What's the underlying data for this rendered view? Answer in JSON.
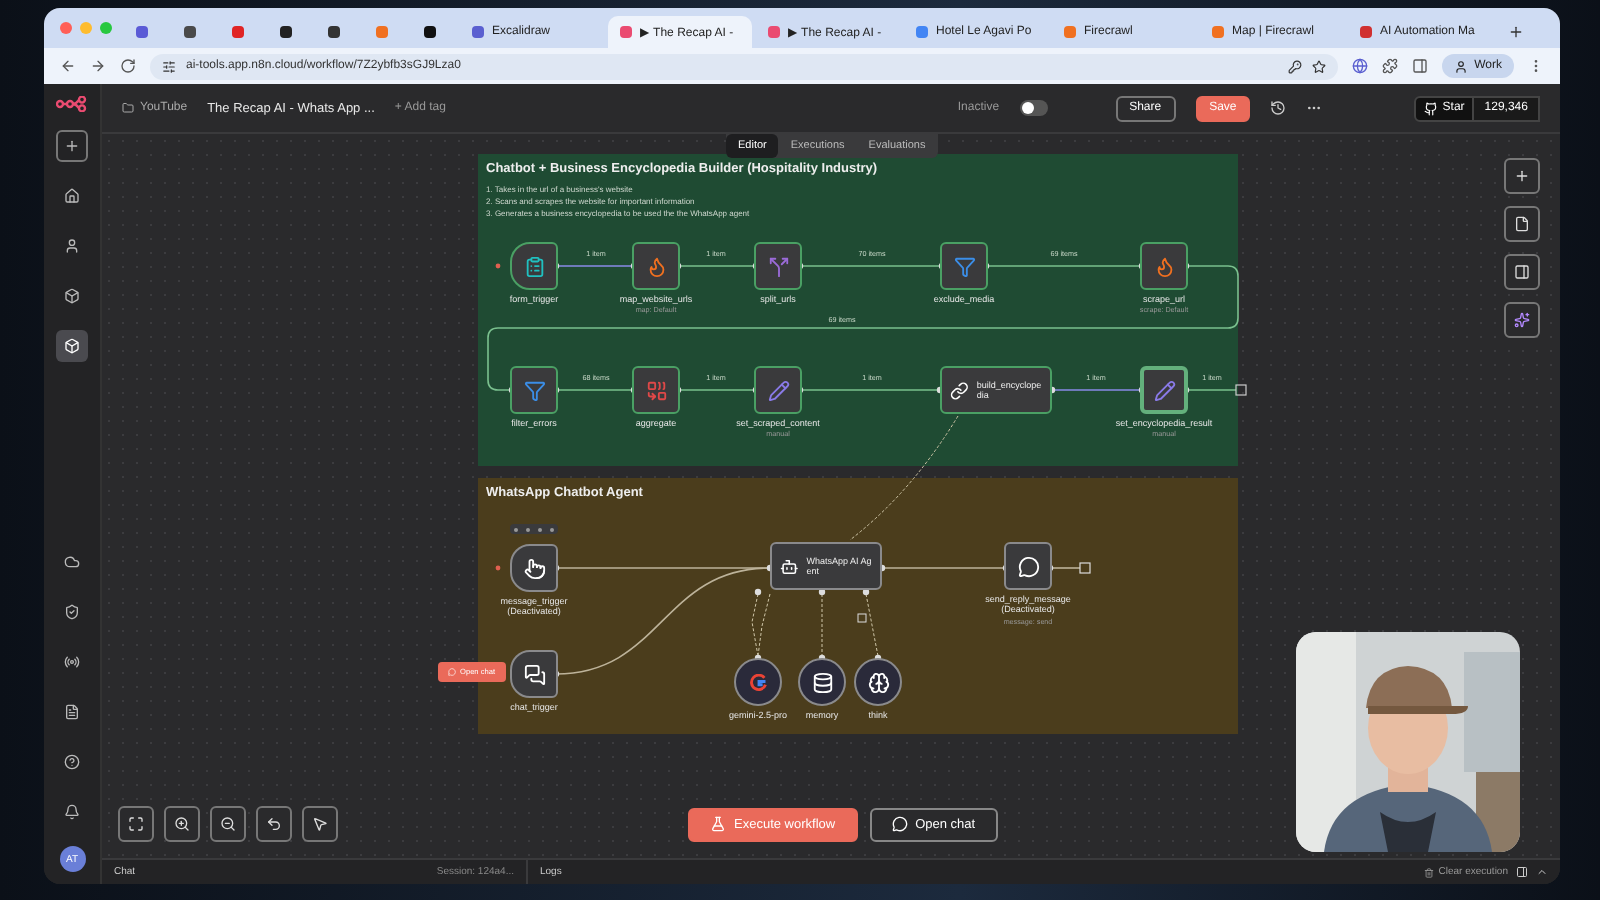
{
  "browser": {
    "tabs": [
      {
        "kind": "icon",
        "color": "#5b5bd6",
        "selected": false
      },
      {
        "kind": "icon",
        "color": "#4a4a4a",
        "selected": false
      },
      {
        "kind": "icon",
        "color": "#e02424",
        "selected": false
      },
      {
        "kind": "icon",
        "color": "#222222",
        "selected": false
      },
      {
        "kind": "icon",
        "color": "#333333",
        "selected": false
      },
      {
        "kind": "icon",
        "color": "#f07020",
        "selected": false
      },
      {
        "kind": "icon",
        "color": "#111111",
        "selected": false
      },
      {
        "kind": "page",
        "label": "Excalidraw",
        "color": "#5a5fd0",
        "selected": false
      },
      {
        "kind": "page",
        "label": "▶ The Recap AI -",
        "color": "#ea4b71",
        "selected": true
      },
      {
        "kind": "page",
        "label": "▶ The Recap AI -",
        "color": "#ea4b71",
        "selected": false
      },
      {
        "kind": "page",
        "label": "Hotel Le Agavi Po",
        "color": "#4285f4",
        "selected": false
      },
      {
        "kind": "page",
        "label": "Firecrawl",
        "color": "#f07020",
        "selected": false
      },
      {
        "kind": "page",
        "label": "Map | Firecrawl",
        "color": "#f07020",
        "selected": false
      },
      {
        "kind": "page",
        "label": "AI Automation Ma",
        "color": "#d03030",
        "selected": false
      }
    ],
    "url": "ai-tools.app.n8n.cloud/workflow/7Z2ybfb3sGJ9Lza0",
    "profile": "Work"
  },
  "header": {
    "breadcrumb": "YouTube",
    "title": "The Recap AI - Whats App ...",
    "add_tag": "+ Add tag",
    "status": "Inactive",
    "active": false,
    "share": "Share",
    "save": "Save",
    "star": "Star",
    "stars_count": "129,346"
  },
  "view_tabs": [
    {
      "label": "Editor",
      "selected": true
    },
    {
      "label": "Executions",
      "selected": false
    },
    {
      "label": "Evaluations",
      "selected": false
    }
  ],
  "notes": [
    {
      "title": "Chatbot + Business Encyclopedia Builder (Hospitality Industry)",
      "color": "#1f4b33",
      "lines": [
        "1. Takes in the url of a business's website",
        "2. Scans and scrapes the website for important information",
        "3. Generates a business encyclopedia to be used the the WhatsApp agent"
      ],
      "nodes": [
        {
          "name": "form_trigger",
          "kind": "trigger",
          "selected": false
        },
        {
          "name": "map_website_urls",
          "subtitle": "map: Default",
          "kind": "action",
          "selected": false
        },
        {
          "name": "split_urls",
          "kind": "action",
          "selected": false
        },
        {
          "name": "exclude_media",
          "kind": "action",
          "selected": false
        },
        {
          "name": "scrape_url",
          "subtitle": "scrape: Default",
          "kind": "action",
          "selected": false
        },
        {
          "name": "filter_errors",
          "kind": "action",
          "selected": false
        },
        {
          "name": "aggregate",
          "kind": "action",
          "selected": false
        },
        {
          "name": "set_scraped_content",
          "subtitle": "manual",
          "kind": "action",
          "selected": false
        },
        {
          "name": "build_encyclopedia",
          "kind": "agent",
          "selected": false
        },
        {
          "name": "set_encyclopedia_result",
          "subtitle": "manual",
          "kind": "action",
          "selected": true
        }
      ],
      "edge_labels": [
        "1 item",
        "1 item",
        "70 items",
        "69 items",
        "69 items",
        "68 items",
        "1 item",
        "1 item",
        "1 item",
        "1 item"
      ]
    },
    {
      "title": "WhatsApp Chatbot Agent",
      "color": "#4b3d1c",
      "nodes": [
        {
          "name": "message_trigger",
          "note": "(Deactivated)",
          "kind": "trigger",
          "selected": false
        },
        {
          "name": "chat_trigger",
          "kind": "trigger",
          "selected": false
        },
        {
          "name": "WhatsApp AI Agent",
          "kind": "agent",
          "selected": false
        },
        {
          "name": "send_reply_message",
          "note": "(Deactivated)",
          "subtitle": "message: send",
          "kind": "action",
          "selected": false
        },
        {
          "name": "gemini-2.5-pro",
          "kind": "sub",
          "selected": false
        },
        {
          "name": "memory",
          "kind": "sub",
          "selected": false
        },
        {
          "name": "think",
          "kind": "sub",
          "selected": false
        }
      ]
    }
  ],
  "open_chat_tag": "Open chat",
  "controls": {
    "execute": "Execute workflow",
    "open_chat": "Open chat"
  },
  "sidebar": {
    "items": [
      {
        "selected": false
      },
      {
        "selected": false
      },
      {
        "selected": false
      },
      {
        "selected": false
      },
      {
        "selected": true
      },
      {
        "selected": false
      },
      {
        "selected": false
      },
      {
        "selected": false
      },
      {
        "selected": false
      },
      {
        "selected": false
      },
      {
        "selected": false
      }
    ],
    "avatar": "AT"
  },
  "logs_bar": {
    "chat": "Chat",
    "session": "Session: 124a4...",
    "logs": "Logs",
    "clear": "Clear execution"
  }
}
